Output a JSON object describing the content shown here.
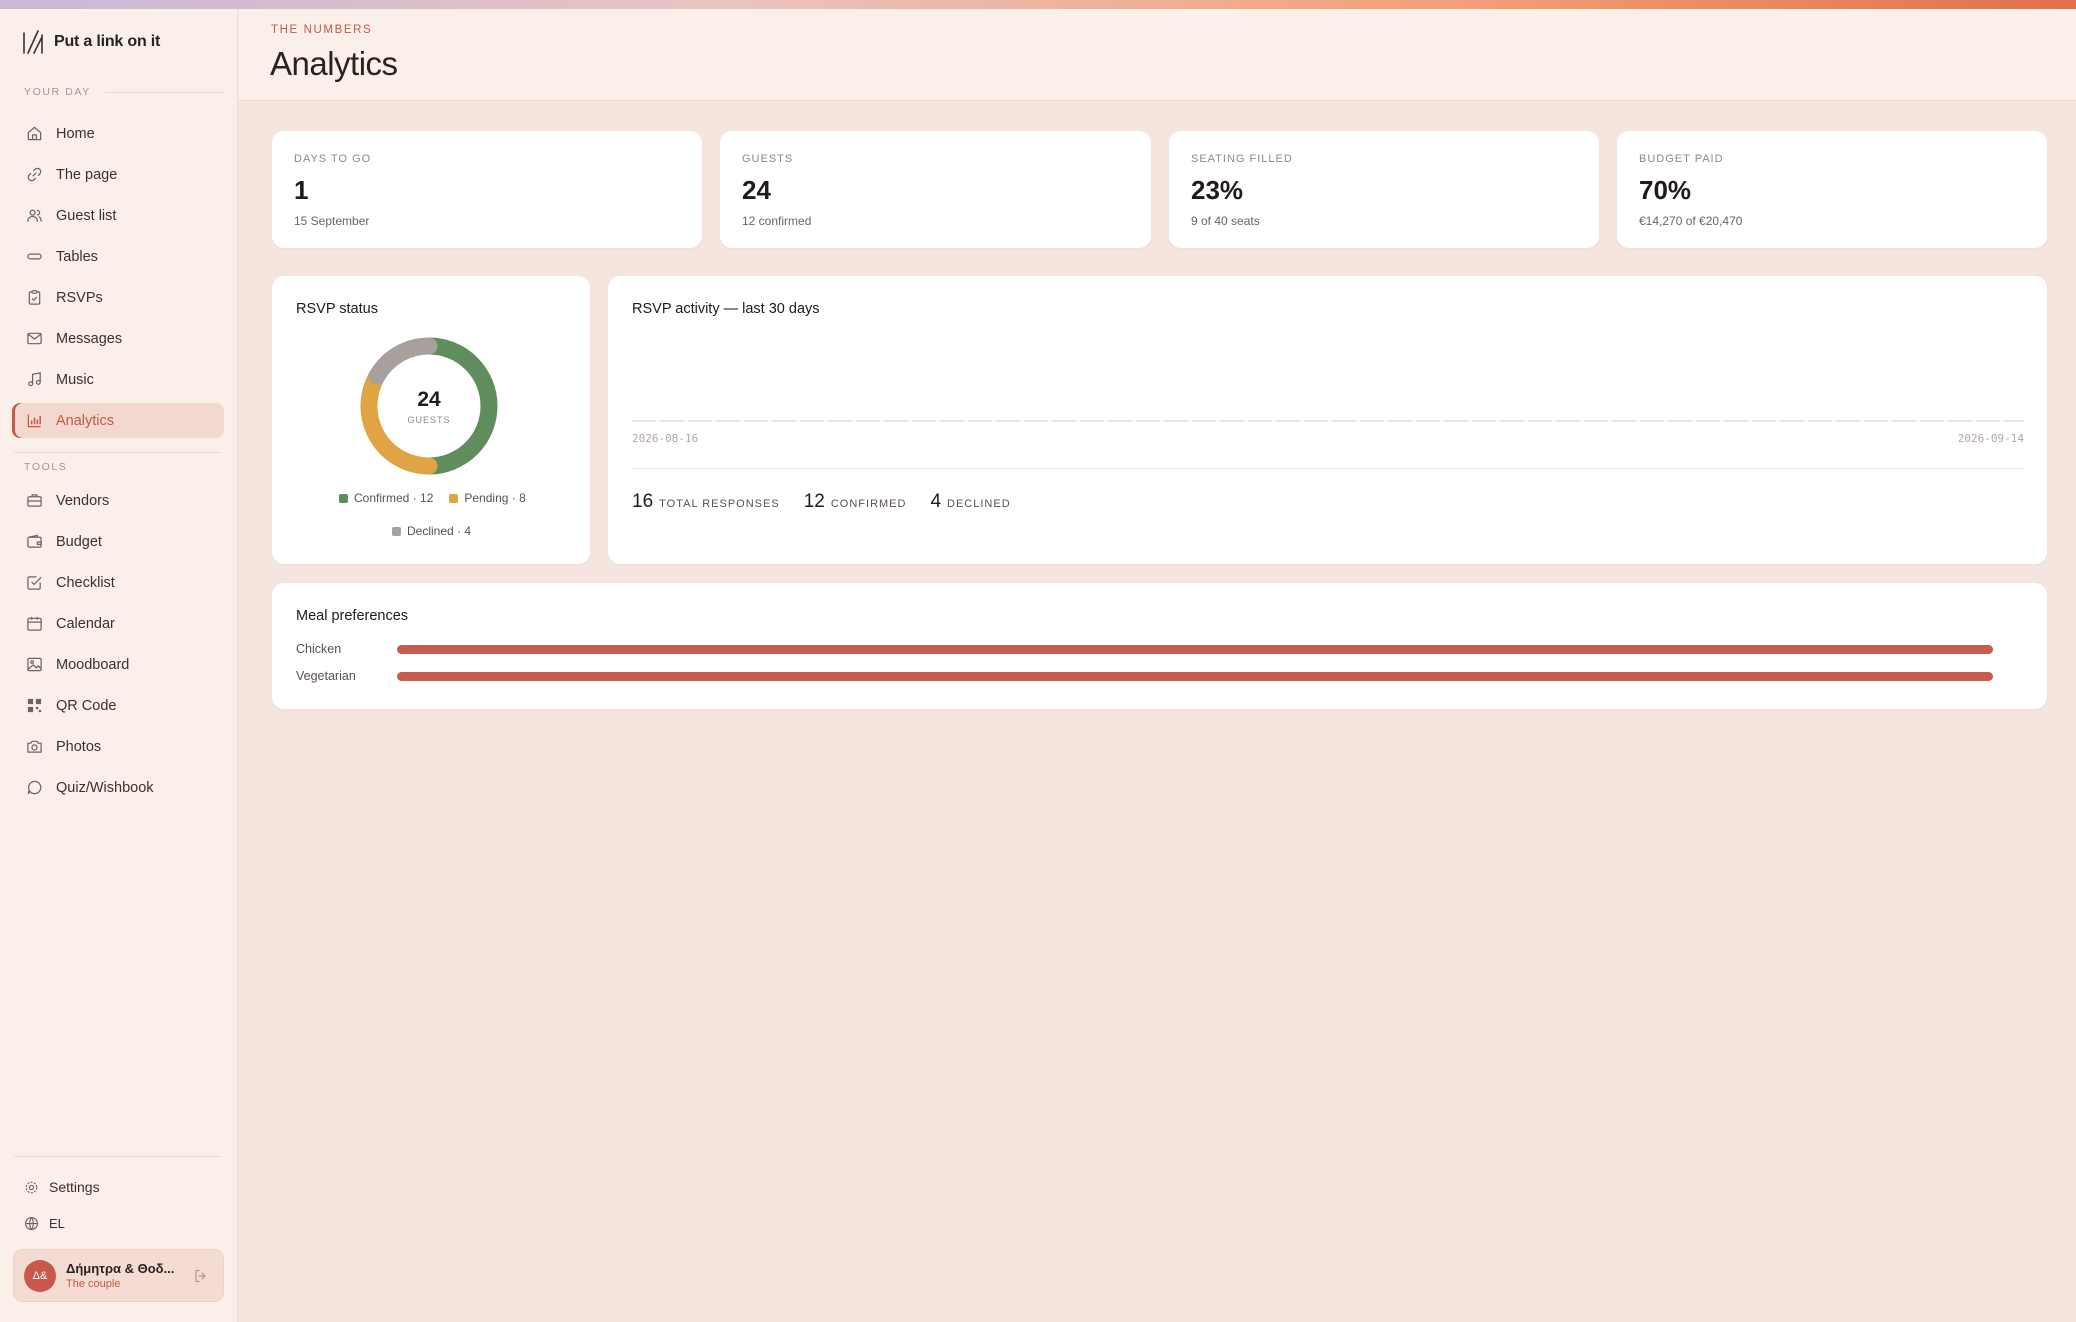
{
  "app": {
    "brand": "Put a link on it"
  },
  "sidebar": {
    "section_day": "YOUR DAY",
    "section_tools": "TOOLS",
    "day_items": [
      {
        "label": "Home",
        "icon": "home-icon"
      },
      {
        "label": "The page",
        "icon": "link-icon"
      },
      {
        "label": "Guest list",
        "icon": "users-icon"
      },
      {
        "label": "Tables",
        "icon": "table-icon"
      },
      {
        "label": "RSVPs",
        "icon": "clipboard-icon"
      },
      {
        "label": "Messages",
        "icon": "mail-icon"
      },
      {
        "label": "Music",
        "icon": "music-icon"
      },
      {
        "label": "Analytics",
        "icon": "chart-icon",
        "active": true
      }
    ],
    "tool_items": [
      {
        "label": "Vendors",
        "icon": "briefcase-icon"
      },
      {
        "label": "Budget",
        "icon": "wallet-icon"
      },
      {
        "label": "Checklist",
        "icon": "checkbox-icon"
      },
      {
        "label": "Calendar",
        "icon": "calendar-icon"
      },
      {
        "label": "Moodboard",
        "icon": "image-icon"
      },
      {
        "label": "QR Code",
        "icon": "qr-icon"
      },
      {
        "label": "Photos",
        "icon": "camera-icon"
      },
      {
        "label": "Quiz/Wishbook",
        "icon": "chat-icon"
      }
    ],
    "settings_label": "Settings",
    "language_label": "EL",
    "user": {
      "initials": "Δ&",
      "name": "Δήμητρα & Θοδ...",
      "role": "The couple"
    }
  },
  "header": {
    "eyebrow": "THE NUMBERS",
    "title": "Analytics"
  },
  "stats": [
    {
      "label": "DAYS TO GO",
      "value": "1",
      "sub": "15 September"
    },
    {
      "label": "GUESTS",
      "value": "24",
      "sub": "12 confirmed"
    },
    {
      "label": "SEATING FILLED",
      "value": "23%",
      "sub": "9 of 40 seats"
    },
    {
      "label": "BUDGET PAID",
      "value": "70%",
      "sub": "€14,270 of €20,470"
    }
  ],
  "rsvp_status": {
    "title": "RSVP status",
    "center_value": "24",
    "center_label": "GUESTS",
    "legend": [
      {
        "label": "Confirmed · 12"
      },
      {
        "label": "Pending · 8"
      },
      {
        "label": "Declined · 4"
      }
    ],
    "colors": {
      "confirmed": "#5f8d5e",
      "pending": "#e0a445",
      "declined": "#a8a09c"
    }
  },
  "rsvp_activity": {
    "title": "RSVP activity — last 30 days",
    "start_date": "2026-08-16",
    "end_date": "2026-09-14",
    "totals": [
      {
        "value": "16",
        "label": "TOTAL RESPONSES"
      },
      {
        "value": "12",
        "label": "CONFIRMED"
      },
      {
        "value": "4",
        "label": "DECLINED"
      }
    ]
  },
  "meal_preferences": {
    "title": "Meal preferences",
    "rows": [
      {
        "label": "Chicken",
        "count": "6",
        "fraction": 1.0
      },
      {
        "label": "Vegetarian",
        "count": "6",
        "fraction": 1.0
      }
    ]
  },
  "chart_data": {
    "type": "pie",
    "title": "RSVP status",
    "categories": [
      "Confirmed",
      "Pending",
      "Declined"
    ],
    "values": [
      12,
      8,
      4
    ],
    "total": 24
  }
}
